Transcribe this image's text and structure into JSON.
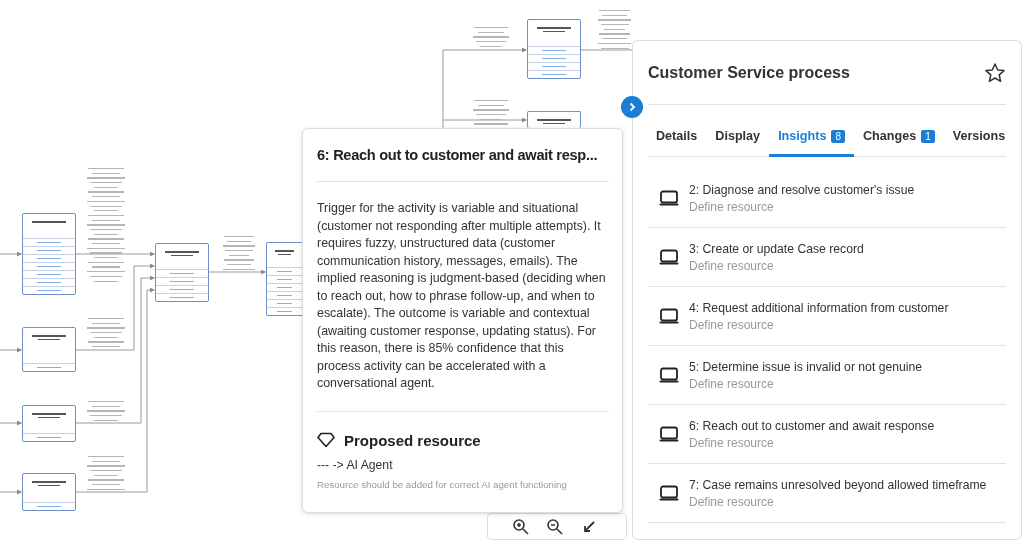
{
  "detail_popup": {
    "title": "6: Reach out to customer and await resp...",
    "description": "Trigger for the activity is variable and situational (customer not responding after multiple attempts). It requires fuzzy, unstructured data (customer communication history, messages, emails). The implied reasoning is judgment-based (deciding when to reach out, how to phrase follow-up, and when to escalate). The outcome is variable and contextual (awaiting customer response, updating status). For this reason, there is 85% confidence that this process activity can be accelerated with a conversational agent.",
    "resource_heading": "Proposed resource",
    "resource_mapping": "--- -> AI Agent",
    "resource_note": "Resource should be added for correct AI agent functioning"
  },
  "panel": {
    "title": "Customer Service process",
    "favorite": false,
    "tabs": [
      {
        "label": "Details",
        "selected": false
      },
      {
        "label": "Display",
        "selected": false
      },
      {
        "label": "Insights",
        "count": "8",
        "selected": true
      },
      {
        "label": "Changes",
        "count": "1",
        "selected": false
      },
      {
        "label": "Versions",
        "selected": false
      }
    ],
    "insights": [
      {
        "title": "2: Diagnose and resolve customer's issue",
        "action": "Define resource"
      },
      {
        "title": "3: Create or update Case record",
        "action": "Define resource"
      },
      {
        "title": "4: Request additional information from customer",
        "action": "Define resource"
      },
      {
        "title": "5: Determine issue is invalid or not genuine",
        "action": "Define resource"
      },
      {
        "title": "6: Reach out to customer and await response",
        "action": "Define resource"
      },
      {
        "title": "7: Case remains unresolved beyond allowed timeframe",
        "action": "Define resource"
      }
    ]
  }
}
